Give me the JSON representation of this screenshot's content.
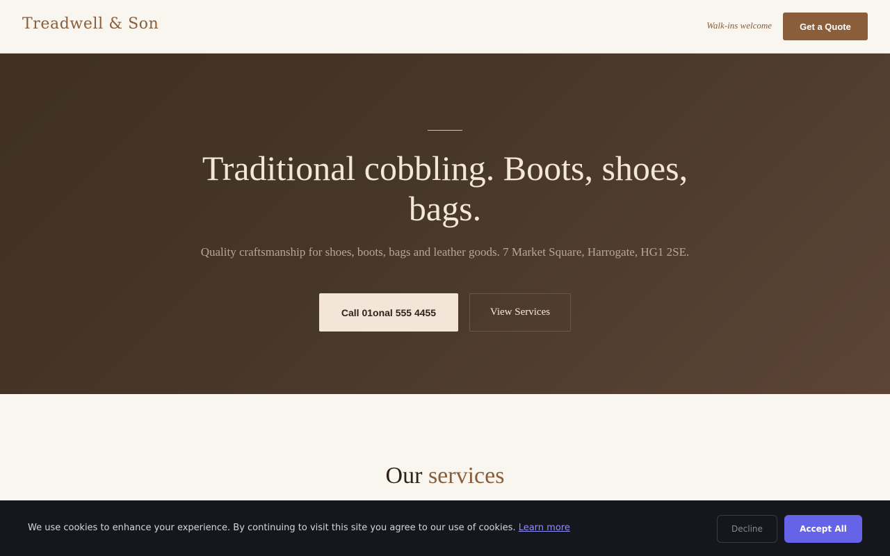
{
  "header": {
    "brand": "Treadwell & Son",
    "walkins": "Walk-ins welcome",
    "quote_label": "Get a Quote"
  },
  "hero": {
    "title": "Traditional cobbling. Boots, shoes, bags.",
    "subtitle": "Quality craftsmanship for shoes, boots, bags and leather goods. 7 Market Square, Harrogate, HG1 2SE.",
    "call_label": "Call 01onal 555 4455",
    "services_label": "View Services"
  },
  "services": {
    "heading_plain": "Our",
    "heading_accent": "services"
  },
  "cookie": {
    "text": "We use cookies to enhance your experience. By continuing to visit this site you agree to our use of cookies.",
    "link": "Learn more",
    "decline": "Decline",
    "accept": "Accept All"
  },
  "colors": {
    "accent": "#8a5d3b",
    "hero_background": "#47372a",
    "cookie_accept": "#6563e8"
  }
}
